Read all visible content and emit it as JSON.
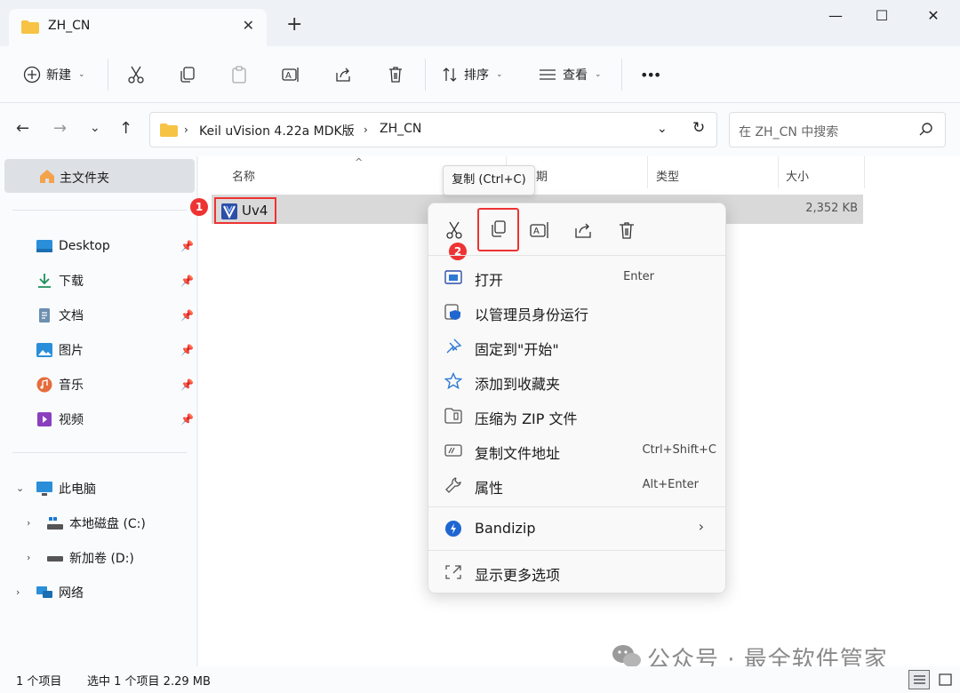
{
  "window": {
    "tab_title": "ZH_CN",
    "colors": {
      "accent": "#0067c0",
      "highlight_red": "#e33333",
      "folder": "#f6c344"
    }
  },
  "toolbar": {
    "new_label": "新建",
    "sort_label": "排序",
    "view_label": "查看",
    "more_label": "•••"
  },
  "address": {
    "segments": [
      "Keil uVision 4.22a MDK版",
      "ZH_CN"
    ],
    "search_placeholder": "在 ZH_CN 中搜索"
  },
  "sidebar": {
    "home": "主文件夹",
    "pinned": [
      "Desktop",
      "下载",
      "文档",
      "图片",
      "音乐",
      "视频"
    ],
    "this_pc": "此电脑",
    "drives": [
      "本地磁盘 (C:)",
      "新加卷 (D:)"
    ],
    "network": "网络"
  },
  "columns": {
    "name": "名称",
    "date": "期",
    "type": "类型",
    "size": "大小"
  },
  "file": {
    "name": "Uv4",
    "size": "2,352 KB"
  },
  "badges": {
    "one": "1",
    "two": "2"
  },
  "tooltip": "复制 (Ctrl+C)",
  "context_menu": {
    "items": [
      {
        "label": "打开",
        "shortcut": "Enter"
      },
      {
        "label": "以管理员身份运行",
        "shortcut": ""
      },
      {
        "label": "固定到\"开始\"",
        "shortcut": ""
      },
      {
        "label": "添加到收藏夹",
        "shortcut": ""
      },
      {
        "label": "压缩为 ZIP 文件",
        "shortcut": ""
      },
      {
        "label": "复制文件地址",
        "shortcut": "Ctrl+Shift+C"
      },
      {
        "label": "属性",
        "shortcut": "Alt+Enter"
      },
      {
        "label": "Bandizip",
        "shortcut": ""
      },
      {
        "label": "显示更多选项",
        "shortcut": ""
      }
    ]
  },
  "status": {
    "count": "1 个项目",
    "selected": "选中 1 个项目  2.29 MB"
  },
  "watermark": "公众号 · 最全软件管家"
}
